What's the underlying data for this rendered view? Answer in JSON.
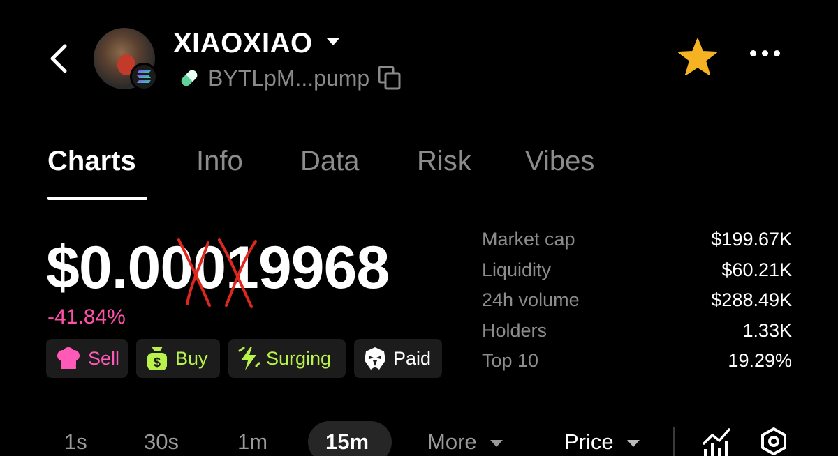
{
  "header": {
    "token_name": "XIAOXIAO",
    "address": "BYTLpM...pump"
  },
  "tabs": [
    {
      "label": "Charts"
    },
    {
      "label": "Info"
    },
    {
      "label": "Data"
    },
    {
      "label": "Risk"
    },
    {
      "label": "Vibes"
    }
  ],
  "price": {
    "value": "$0.00019968",
    "change": "-41.84%"
  },
  "badges": {
    "sell": "Sell",
    "buy": "Buy",
    "surging": "Surging",
    "paid": "Paid"
  },
  "stats": [
    {
      "label": "Market cap",
      "value": "$199.67K"
    },
    {
      "label": "Liquidity",
      "value": "$60.21K"
    },
    {
      "label": "24h volume",
      "value": "$288.49K"
    },
    {
      "label": "Holders",
      "value": "1.33K"
    },
    {
      "label": "Top 10",
      "value": "19.29%"
    }
  ],
  "timeframes": [
    {
      "label": "1s"
    },
    {
      "label": "30s"
    },
    {
      "label": "1m"
    },
    {
      "label": "15m"
    },
    {
      "label": "More"
    }
  ],
  "price_selector": "Price",
  "colors": {
    "background": "#000000",
    "negative": "#ff4fa8",
    "accent_green": "#b8f24a",
    "star": "#f5b324",
    "muted": "#8c8c8c"
  },
  "icons": [
    "back-icon",
    "solana-icon",
    "pill-icon",
    "copy-icon",
    "star-icon",
    "more-icon",
    "chef-hat-icon",
    "money-bag-icon",
    "lightning-icon",
    "eagle-icon",
    "chevron-down-icon",
    "chart-type-icon",
    "settings-hex-icon"
  ]
}
